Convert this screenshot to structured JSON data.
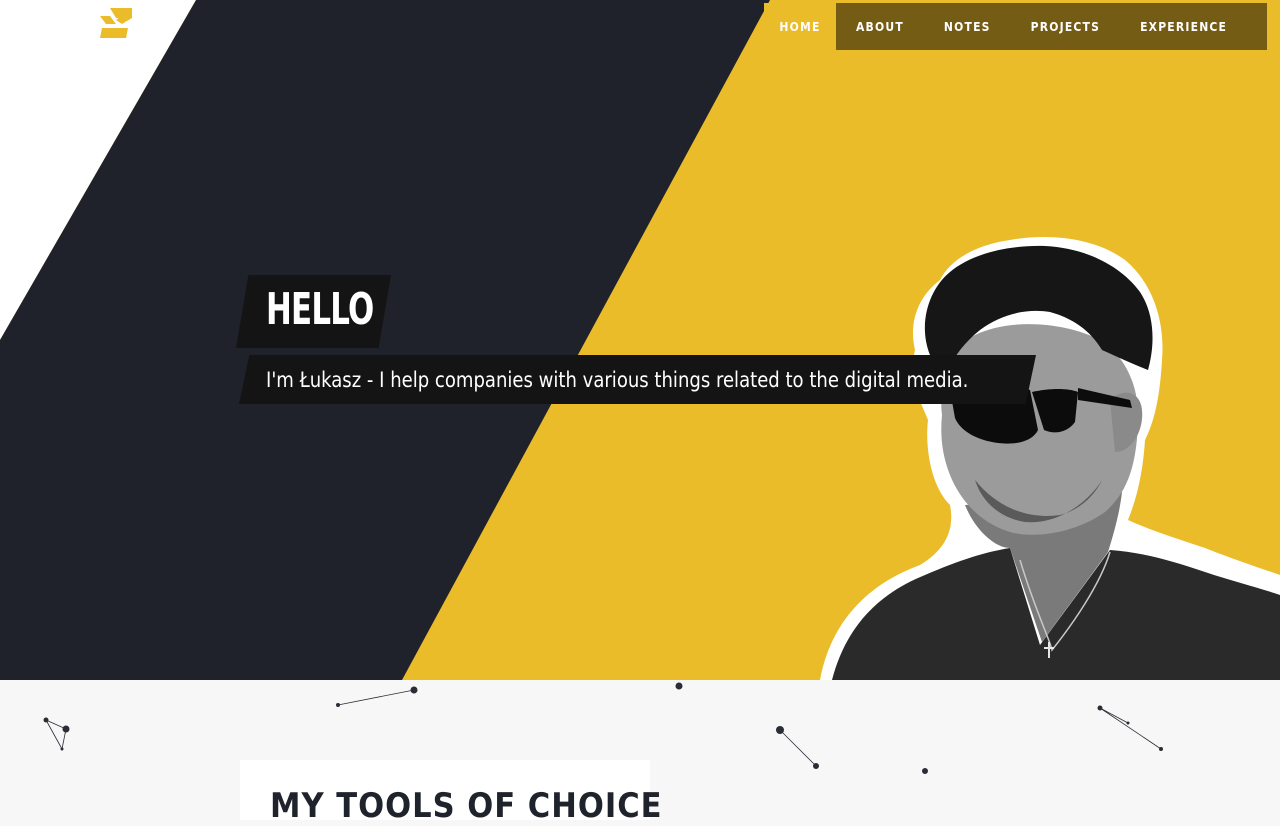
{
  "logo": {
    "icon": "logo-icon",
    "color": "#ebbc2a"
  },
  "nav": {
    "items": [
      {
        "label": "HOME",
        "active": true
      },
      {
        "label": "ABOUT"
      },
      {
        "label": "NOTES"
      },
      {
        "label": "PROJECTS"
      },
      {
        "label": "EXPERIENCE"
      }
    ]
  },
  "hero": {
    "greeting": "HELLO",
    "tagline": "I'm Łukasz - I help companies with various things related to the digital media.",
    "colors": {
      "accent": "#ebbc2a",
      "dark": "#1f222a"
    }
  },
  "tools": {
    "title": "MY TOOLS OF CHOICE"
  }
}
